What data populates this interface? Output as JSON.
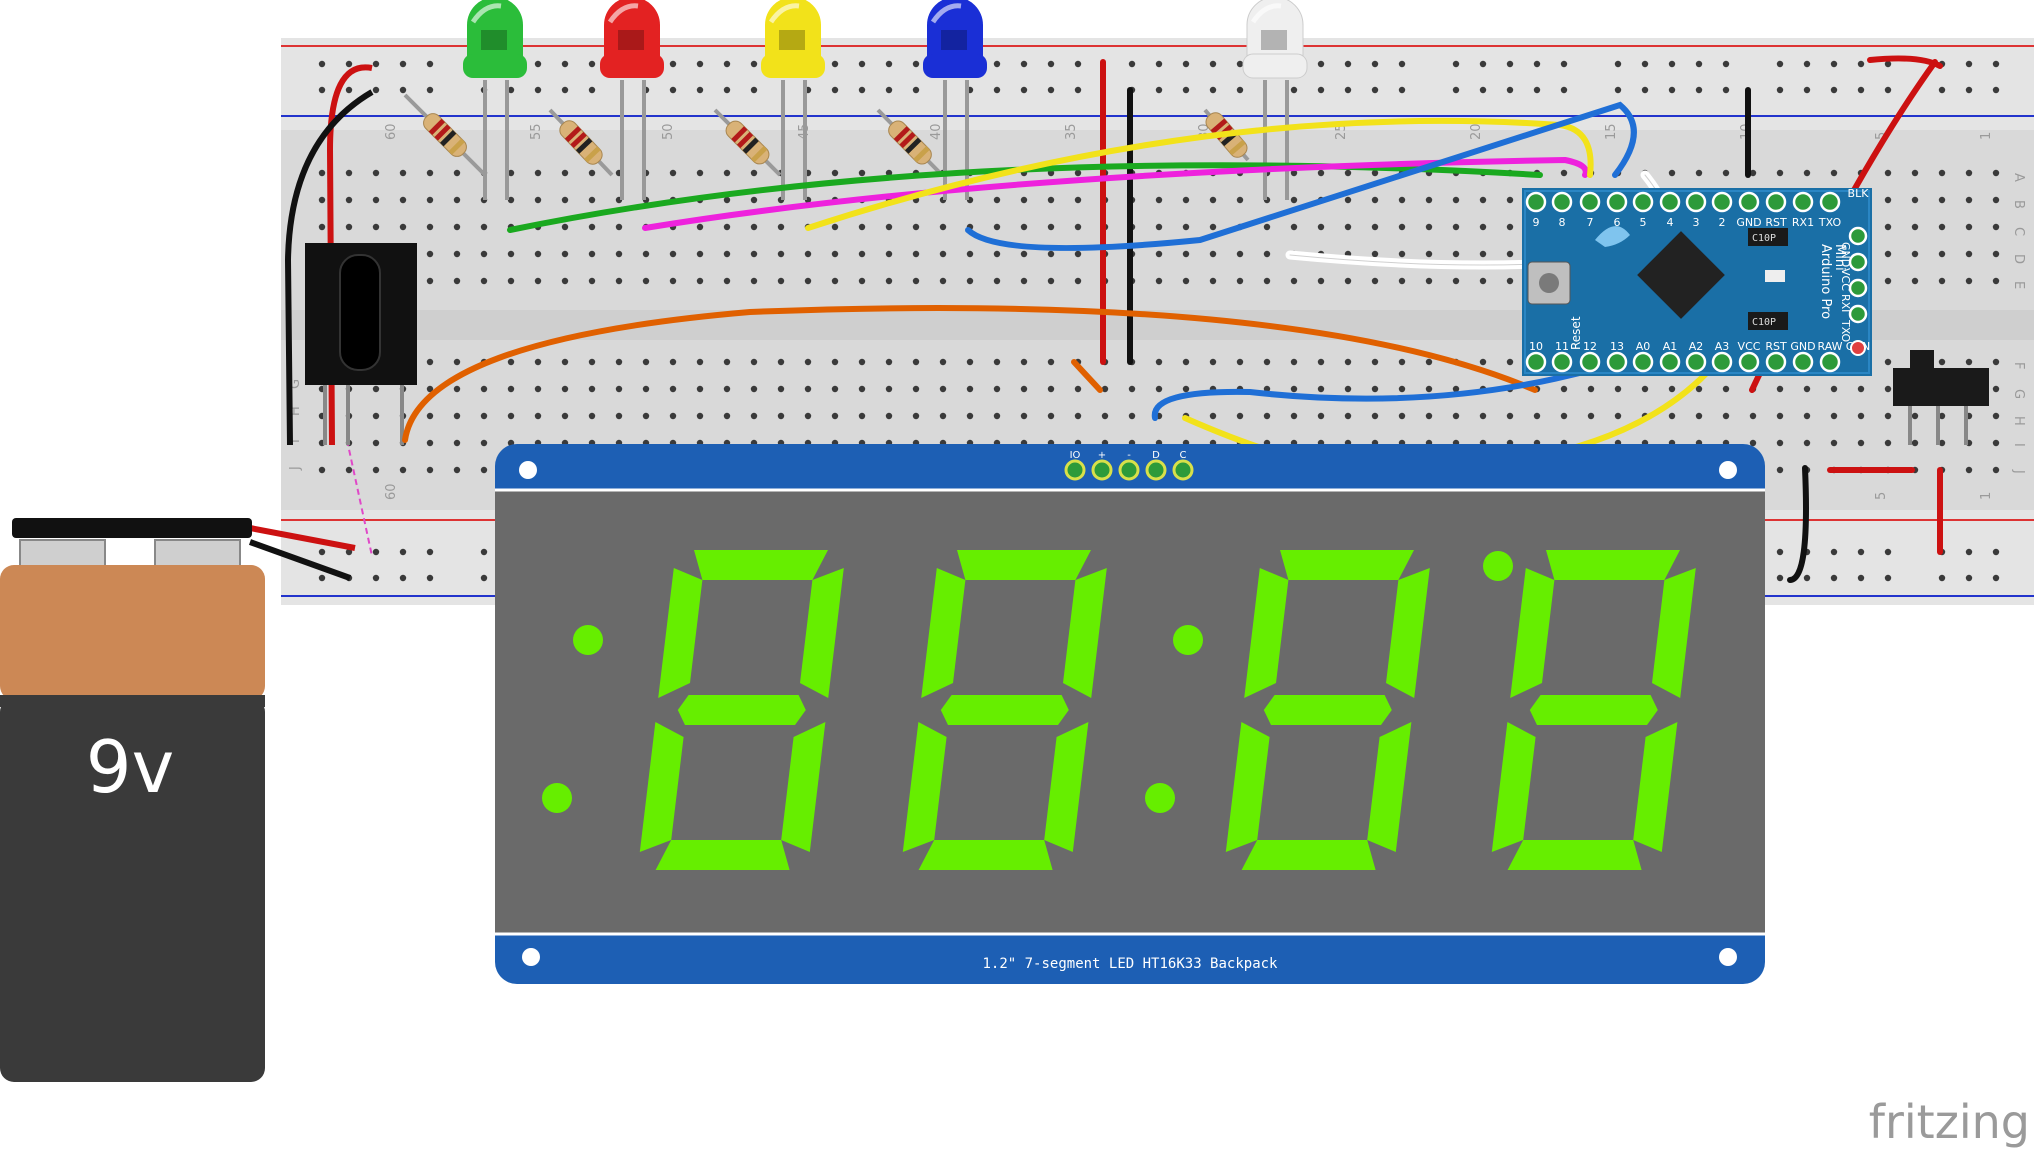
{
  "battery": {
    "label": "9v"
  },
  "display": {
    "pin_labels": [
      "IO",
      "+",
      "-",
      "D",
      "C"
    ],
    "caption": "1.2\" 7-segment LED HT16K33 Backpack",
    "segment_color": "#66ee00",
    "body_color": "#6a6a6a",
    "board_color": "#1d5fb4"
  },
  "arduino": {
    "name_lines": [
      "Mini",
      "Arduino Pro"
    ],
    "top_pins": [
      "9",
      "8",
      "7",
      "6",
      "5",
      "4",
      "3",
      "2",
      "GND",
      "RST",
      "RX1",
      "TXO"
    ],
    "right_pins": [
      "BLK",
      "GND",
      "VCC",
      "RXI",
      "TXO",
      "GRN"
    ],
    "bottom_pins": [
      "10",
      "11",
      "12",
      "13",
      "A0",
      "A1",
      "A2",
      "A3",
      "VCC",
      "RST",
      "GND",
      "RAW"
    ],
    "cap_labels": [
      "C10P",
      "C10P"
    ],
    "reset_label": "Reset"
  },
  "breadboard": {
    "row_letters_left": [
      "G",
      "H",
      "I",
      "J"
    ],
    "row_letters_right": [
      "A",
      "B",
      "C",
      "D",
      "E",
      "F",
      "G",
      "H",
      "I",
      "J"
    ],
    "col_numbers_top": [
      "60",
      "55",
      "50",
      "45",
      "40",
      "35",
      "30",
      "25",
      "20",
      "15",
      "10",
      "5",
      "1"
    ],
    "col_numbers_bottom": [
      "60",
      "5",
      "1"
    ]
  },
  "leds": [
    {
      "name": "green",
      "color": "#2bbd3a"
    },
    {
      "name": "red",
      "color": "#e32222"
    },
    {
      "name": "yellow",
      "color": "#f2e21a"
    },
    {
      "name": "blue",
      "color": "#1a2fd6"
    },
    {
      "name": "white",
      "color": "#efefef"
    }
  ],
  "watermark": "fritzing"
}
